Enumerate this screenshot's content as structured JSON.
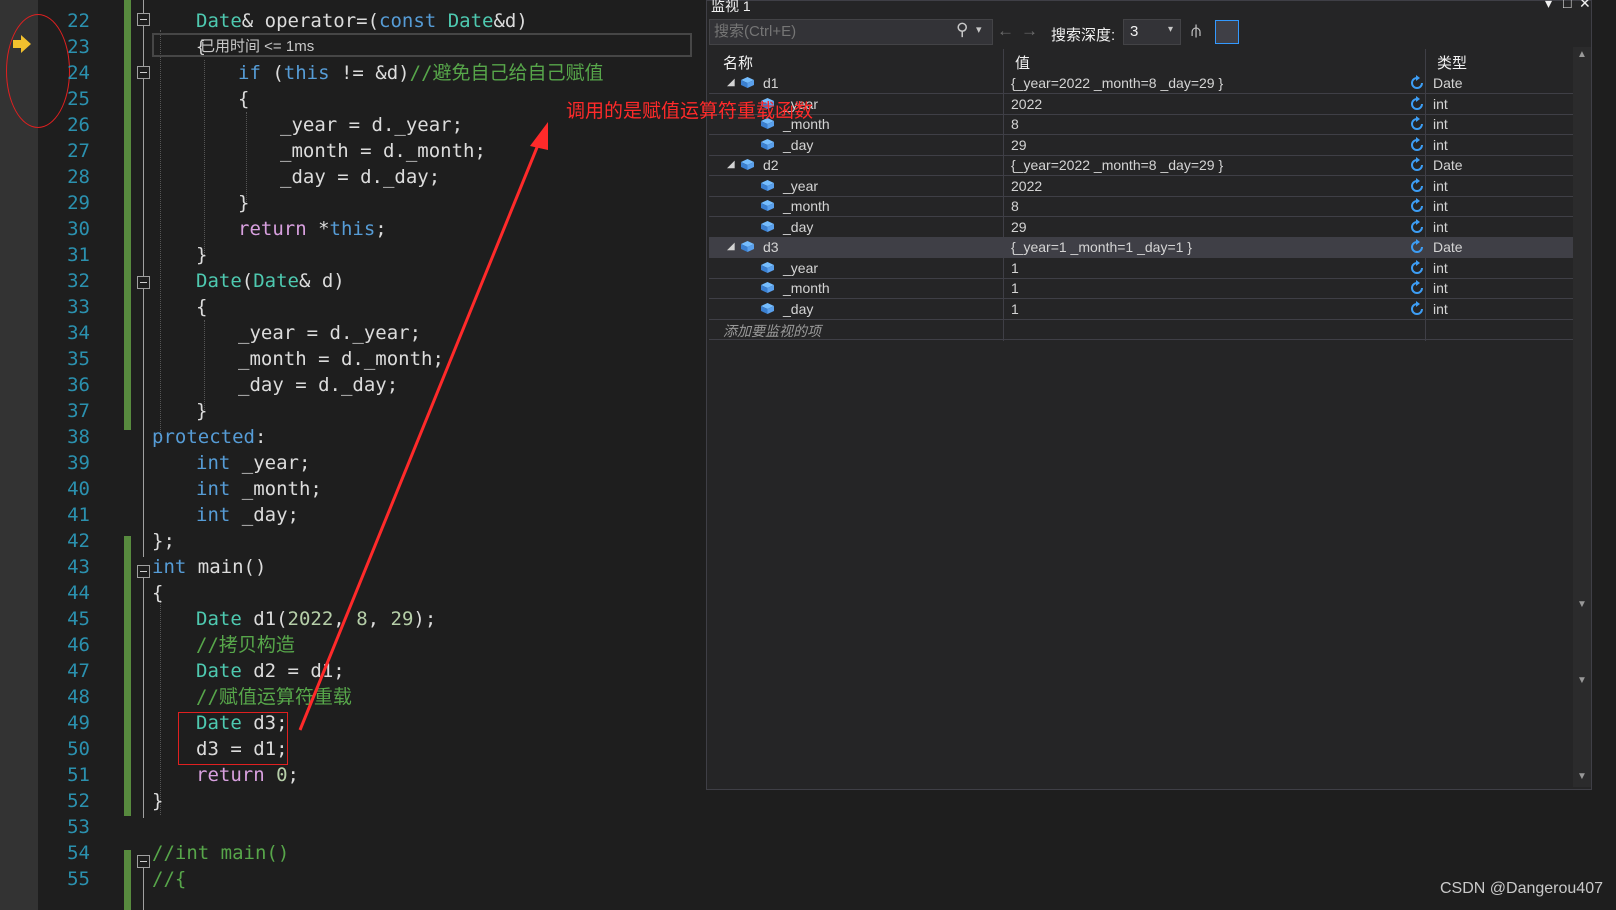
{
  "editor": {
    "line_numbers": [
      "22",
      "23",
      "24",
      "25",
      "26",
      "27",
      "28",
      "29",
      "30",
      "31",
      "32",
      "33",
      "34",
      "35",
      "36",
      "37",
      "38",
      "39",
      "40",
      "41",
      "42",
      "43",
      "44",
      "45",
      "46",
      "47",
      "48",
      "49",
      "50",
      "51",
      "52",
      "53",
      "54",
      "55"
    ],
    "perf_tip": "已用时间 <= 1ms",
    "lines": {
      "l22": {
        "a": "Date",
        "b": "& operator=(",
        "c": "const",
        "d": " ",
        "e": "Date",
        "f": "&d)"
      },
      "l23": {
        "a": "{"
      },
      "l24": {
        "a": "if",
        "b": " (",
        "c": "this",
        "d": " != &d)",
        "e": "//避免自己给自己赋值"
      },
      "l25": {
        "a": "{"
      },
      "l26": {
        "a": "_year = d._year;"
      },
      "l27": {
        "a": "_month = d._month;"
      },
      "l28": {
        "a": "_day = d._day;"
      },
      "l29": {
        "a": "}"
      },
      "l30": {
        "a": "return",
        "b": " *",
        "c": "this",
        "d": ";"
      },
      "l31": {
        "a": "}"
      },
      "l32": {
        "a": "Date",
        "b": "(",
        "c": "Date",
        "d": "& d)"
      },
      "l33": {
        "a": "{"
      },
      "l34": {
        "a": "_year = d._year;"
      },
      "l35": {
        "a": "_month = d._month;"
      },
      "l36": {
        "a": "_day = d._day;"
      },
      "l37": {
        "a": "}"
      },
      "l38": {
        "a": "protected",
        "b": ":"
      },
      "l39": {
        "a": "int",
        "b": " _year;"
      },
      "l40": {
        "a": "int",
        "b": " _month;"
      },
      "l41": {
        "a": "int",
        "b": " _day;"
      },
      "l42": {
        "a": "};"
      },
      "l43": {
        "a": "int",
        "b": " main()"
      },
      "l44": {
        "a": "{"
      },
      "l45": {
        "a": "Date",
        "b": " d1(",
        "c": "2022",
        "d": ", ",
        "e": "8",
        "f": ", ",
        "g": "29",
        "h": ");"
      },
      "l46": {
        "a": "//拷贝构造"
      },
      "l47": {
        "a": "Date",
        "b": " d2 = d1;"
      },
      "l48": {
        "a": "//赋值运算符重载"
      },
      "l49": {
        "a": "Date",
        "b": " d3;"
      },
      "l50": {
        "a": "d3 = d1;"
      },
      "l51": {
        "a": "return",
        "b": " ",
        "c": "0",
        "d": ";"
      },
      "l52": {
        "a": "}"
      },
      "l54": {
        "a": "//int main()"
      },
      "l55": {
        "a": "//{"
      }
    }
  },
  "annotation": "调用的是赋值运算符重载函数",
  "watch": {
    "title": "监视 1",
    "search_placeholder": "搜索(Ctrl+E)",
    "depth_label": "搜索深度:",
    "depth_value": "3",
    "columns": {
      "name": "名称",
      "value": "值",
      "type": "类型"
    },
    "rows": [
      {
        "name": "d1",
        "value": "{_year=2022 _month=8 _day=29 }",
        "type": "Date"
      },
      {
        "name": "_year",
        "value": "2022",
        "type": "int"
      },
      {
        "name": "_month",
        "value": "8",
        "type": "int"
      },
      {
        "name": "_day",
        "value": "29",
        "type": "int"
      },
      {
        "name": "d2",
        "value": "{_year=2022 _month=8 _day=29 }",
        "type": "Date"
      },
      {
        "name": "_year",
        "value": "2022",
        "type": "int"
      },
      {
        "name": "_month",
        "value": "8",
        "type": "int"
      },
      {
        "name": "_day",
        "value": "29",
        "type": "int"
      },
      {
        "name": "d3",
        "value": "{_year=1 _month=1 _day=1 }",
        "type": "Date"
      },
      {
        "name": "_year",
        "value": "1",
        "type": "int"
      },
      {
        "name": "_month",
        "value": "1",
        "type": "int"
      },
      {
        "name": "_day",
        "value": "1",
        "type": "int"
      }
    ],
    "add_item": "添加要监视的项"
  },
  "watermark": "CSDN @Dangerou407",
  "colors": {
    "keyword": "#569cd6",
    "type": "#4ec9b0",
    "comment": "#57a64a",
    "annotation": "#ff2a2a"
  }
}
